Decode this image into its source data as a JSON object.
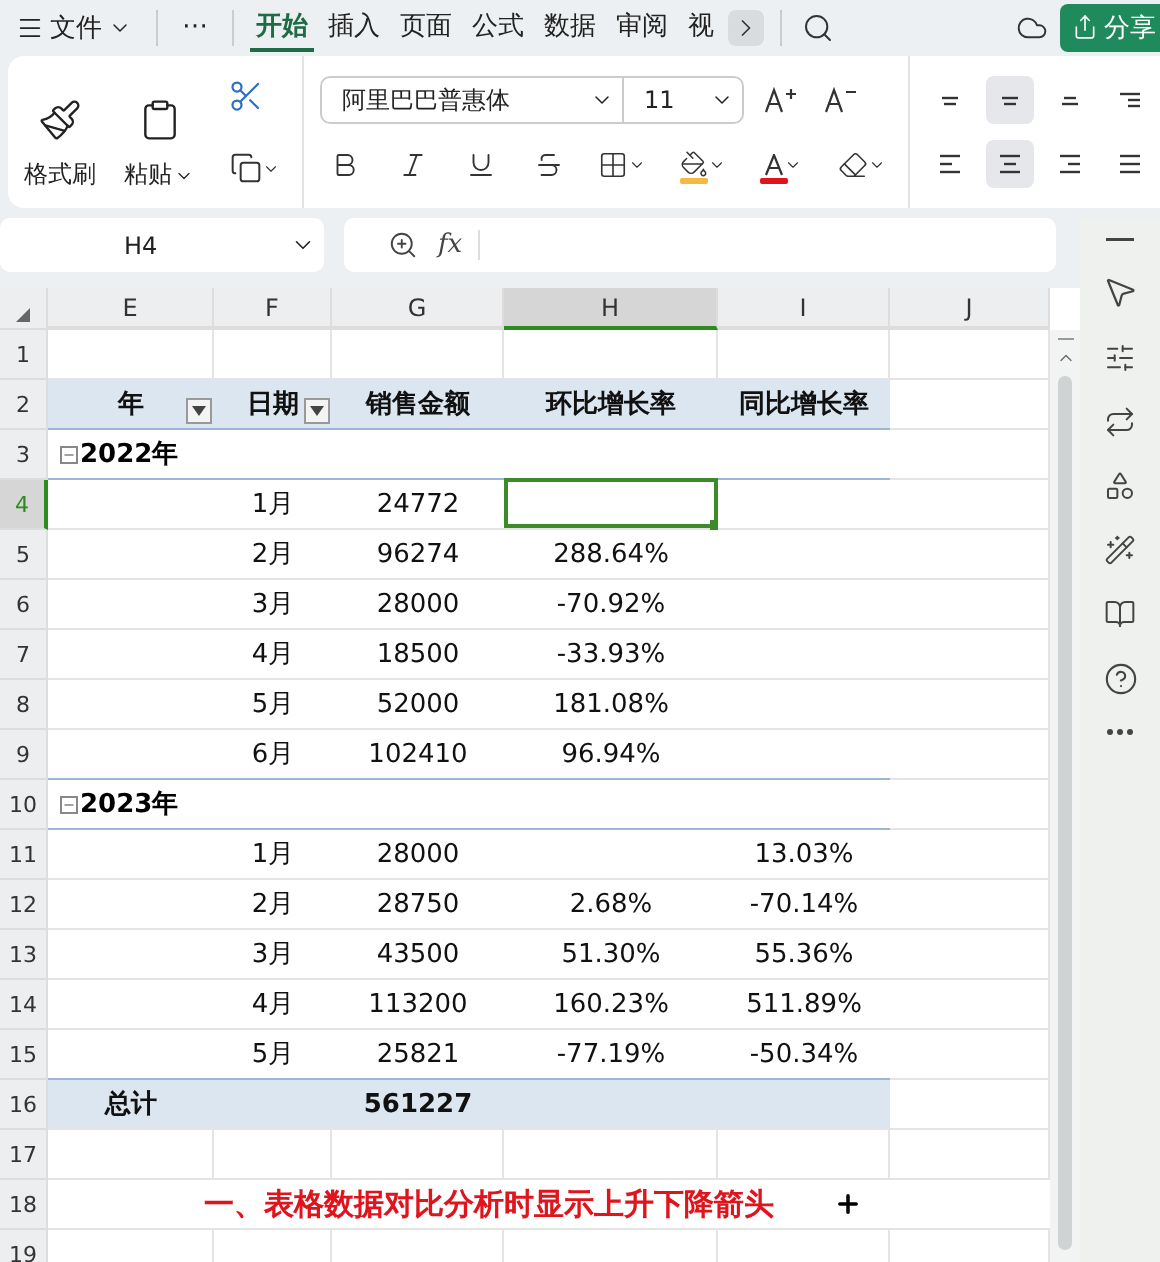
{
  "menu": {
    "file": "文件",
    "more": "⋯",
    "tabs": [
      {
        "label": "开始",
        "selected": true
      },
      {
        "label": "插入",
        "selected": false
      },
      {
        "label": "页面",
        "selected": false
      },
      {
        "label": "公式",
        "selected": false
      },
      {
        "label": "数据",
        "selected": false
      },
      {
        "label": "审阅",
        "selected": false
      },
      {
        "label": "视",
        "selected": false
      }
    ],
    "share": "分享"
  },
  "ribbon": {
    "format_painter": "格式刷",
    "paste": "粘贴",
    "font": "阿里巴巴普惠体",
    "size": "11",
    "align_top": [
      {
        "kind": "top",
        "selected": false
      },
      {
        "kind": "middle",
        "selected": true
      },
      {
        "kind": "bottom",
        "selected": false
      },
      {
        "kind": "indent",
        "selected": false
      }
    ],
    "align_bottom": [
      {
        "kind": "left",
        "selected": false
      },
      {
        "kind": "center",
        "selected": true
      },
      {
        "kind": "right",
        "selected": false
      },
      {
        "kind": "justify",
        "selected": false
      }
    ]
  },
  "formula_bar": {
    "cell": "H4",
    "fx": "fx"
  },
  "columns": [
    {
      "label": "E",
      "selected": false
    },
    {
      "label": "F",
      "selected": false
    },
    {
      "label": "G",
      "selected": false
    },
    {
      "label": "H",
      "selected": true
    },
    {
      "label": "I",
      "selected": false
    },
    {
      "label": "J",
      "selected": false
    }
  ],
  "rows": [
    {
      "num": "1",
      "kind": "empty",
      "selected": false
    },
    {
      "num": "2",
      "kind": "header",
      "selected": false,
      "cells": [
        {
          "text": "年",
          "filter": true
        },
        {
          "text": "日期",
          "filter": true
        },
        {
          "text": "销售金额",
          "filter": false
        },
        {
          "text": "环比增长率",
          "filter": false
        },
        {
          "text": "同比增长率",
          "filter": false
        }
      ]
    },
    {
      "num": "3",
      "kind": "group",
      "selected": false,
      "label": "2022年",
      "expanded": true
    },
    {
      "num": "4",
      "kind": "data",
      "selected": true,
      "month": "1月",
      "amount": "24772"
    },
    {
      "num": "5",
      "kind": "data",
      "selected": false,
      "month": "2月",
      "amount": "96274",
      "mom": "288.64%"
    },
    {
      "num": "6",
      "kind": "data",
      "selected": false,
      "month": "3月",
      "amount": "28000",
      "mom": "-70.92%"
    },
    {
      "num": "7",
      "kind": "data",
      "selected": false,
      "month": "4月",
      "amount": "18500",
      "mom": "-33.93%"
    },
    {
      "num": "8",
      "kind": "data",
      "selected": false,
      "month": "5月",
      "amount": "52000",
      "mom": "181.08%"
    },
    {
      "num": "9",
      "kind": "data",
      "selected": false,
      "month": "6月",
      "amount": "102410",
      "mom": "96.94%"
    },
    {
      "num": "10",
      "kind": "group",
      "selected": false,
      "label": "2023年",
      "expanded": true
    },
    {
      "num": "11",
      "kind": "data",
      "selected": false,
      "month": "1月",
      "amount": "28000",
      "yoy": "13.03%"
    },
    {
      "num": "12",
      "kind": "data",
      "selected": false,
      "month": "2月",
      "amount": "28750",
      "mom": "2.68%",
      "yoy": "-70.14%"
    },
    {
      "num": "13",
      "kind": "data",
      "selected": false,
      "month": "3月",
      "amount": "43500",
      "mom": "51.30%",
      "yoy": "55.36%"
    },
    {
      "num": "14",
      "kind": "data",
      "selected": false,
      "month": "4月",
      "amount": "113200",
      "mom": "160.23%",
      "yoy": "511.89%"
    },
    {
      "num": "15",
      "kind": "data",
      "selected": false,
      "month": "5月",
      "amount": "25821",
      "mom": "-77.19%",
      "yoy": "-50.34%"
    },
    {
      "num": "16",
      "kind": "total",
      "selected": false,
      "label": "总计",
      "amount": "561227"
    },
    {
      "num": "17",
      "kind": "empty",
      "selected": false
    },
    {
      "num": "18",
      "kind": "note",
      "selected": false,
      "text": "一、表格数据对比分析时显示上升下降箭头"
    },
    {
      "num": "19",
      "kind": "empty",
      "selected": false
    }
  ]
}
